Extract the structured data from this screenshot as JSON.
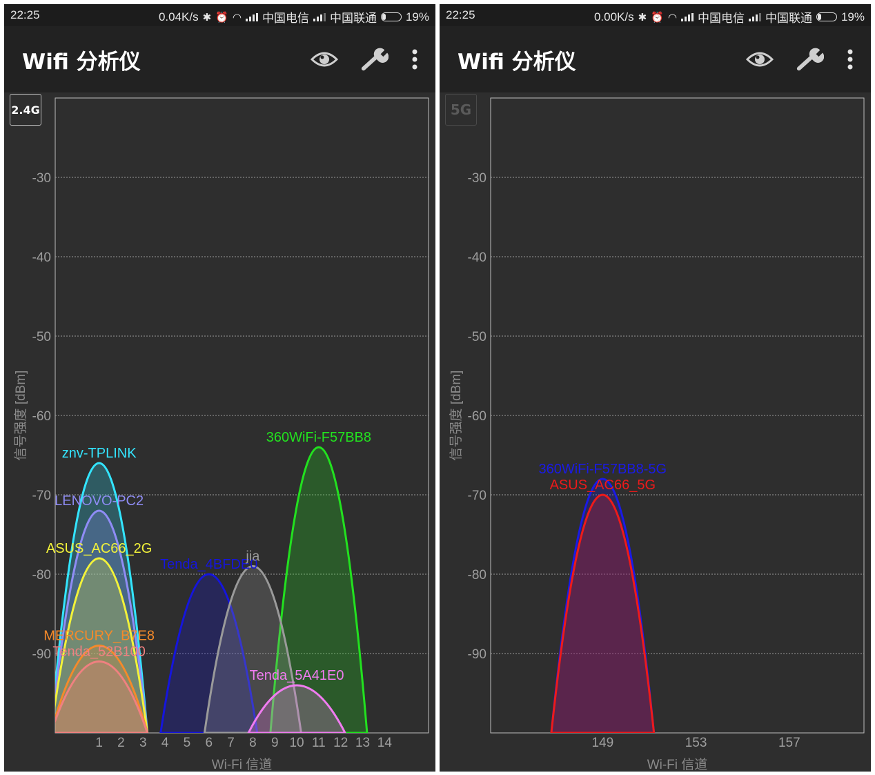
{
  "left": {
    "status": {
      "time": "22:25",
      "speed": "0.04K/s",
      "carrier1": "中国电信",
      "carrier2": "中国联通",
      "battery": "19%",
      "battery_level": 0.19
    },
    "appbar": {
      "title": "Wifi 分析仪",
      "icons": [
        "eye-icon",
        "wrench-icon",
        "more-vert-icon"
      ]
    },
    "band_button": "2.4G",
    "band_active": true,
    "chart_data": {
      "type": "area",
      "xlabel": "Wi-Fi 信道",
      "ylabel": "信号强度 [dBm]",
      "xlim": [
        -1,
        16
      ],
      "ylim": [
        -100,
        -20
      ],
      "yticks": [
        -30,
        -40,
        -50,
        -60,
        -70,
        -80,
        -90
      ],
      "xticks": [
        1,
        2,
        3,
        4,
        5,
        6,
        7,
        8,
        9,
        10,
        11,
        12,
        13,
        14
      ],
      "grid": true,
      "series": [
        {
          "name": "360WiFi-F57BB8",
          "channel": 11,
          "dbm": -64,
          "color": "#22e11f"
        },
        {
          "name": "znv-TPLINK",
          "channel": 1,
          "dbm": -66,
          "color": "#33e5ff"
        },
        {
          "name": "LENOVO-PC2",
          "channel": 1,
          "dbm": -72,
          "color": "#8f8cf5"
        },
        {
          "name": "ASUS_AC66_2G",
          "channel": 1,
          "dbm": -78,
          "color": "#f2f23a"
        },
        {
          "name": "Tenda_4BFDE0",
          "channel": 6,
          "dbm": -80,
          "color": "#1515dd"
        },
        {
          "name": "jia",
          "channel": 8,
          "dbm": -79,
          "color": "#9a9a9a"
        },
        {
          "name": "MERCURY_B7E8",
          "channel": 1,
          "dbm": -89,
          "color": "#f58a2a"
        },
        {
          "name": "Tenda_52B100",
          "channel": 1,
          "dbm": -91,
          "color": "#f08080"
        },
        {
          "name": "Tenda_5A41E0",
          "channel": 10,
          "dbm": -94,
          "color": "#f07cf0"
        }
      ]
    }
  },
  "right": {
    "status": {
      "time": "22:25",
      "speed": "0.00K/s",
      "carrier1": "中国电信",
      "carrier2": "中国联通",
      "battery": "19%",
      "battery_level": 0.19
    },
    "appbar": {
      "title": "Wifi 分析仪",
      "icons": [
        "eye-icon",
        "wrench-icon",
        "more-vert-icon"
      ]
    },
    "band_button": "5G",
    "band_active": false,
    "chart_data": {
      "type": "area",
      "xlabel": "Wi-Fi 信道",
      "ylabel": "信号强度 [dBm]",
      "xlim": [
        144.2,
        160.2
      ],
      "ylim": [
        -100,
        -20
      ],
      "yticks": [
        -30,
        -40,
        -50,
        -60,
        -70,
        -80,
        -90
      ],
      "xticks": [
        149,
        153,
        157
      ],
      "grid": true,
      "series": [
        {
          "name": "360WiFi-F57BB8-5G",
          "channel": 149,
          "dbm": -68,
          "color": "#1a1ae6"
        },
        {
          "name": "ASUS_AC66_5G",
          "channel": 149,
          "dbm": -70,
          "color": "#ee1a1a"
        }
      ]
    }
  }
}
